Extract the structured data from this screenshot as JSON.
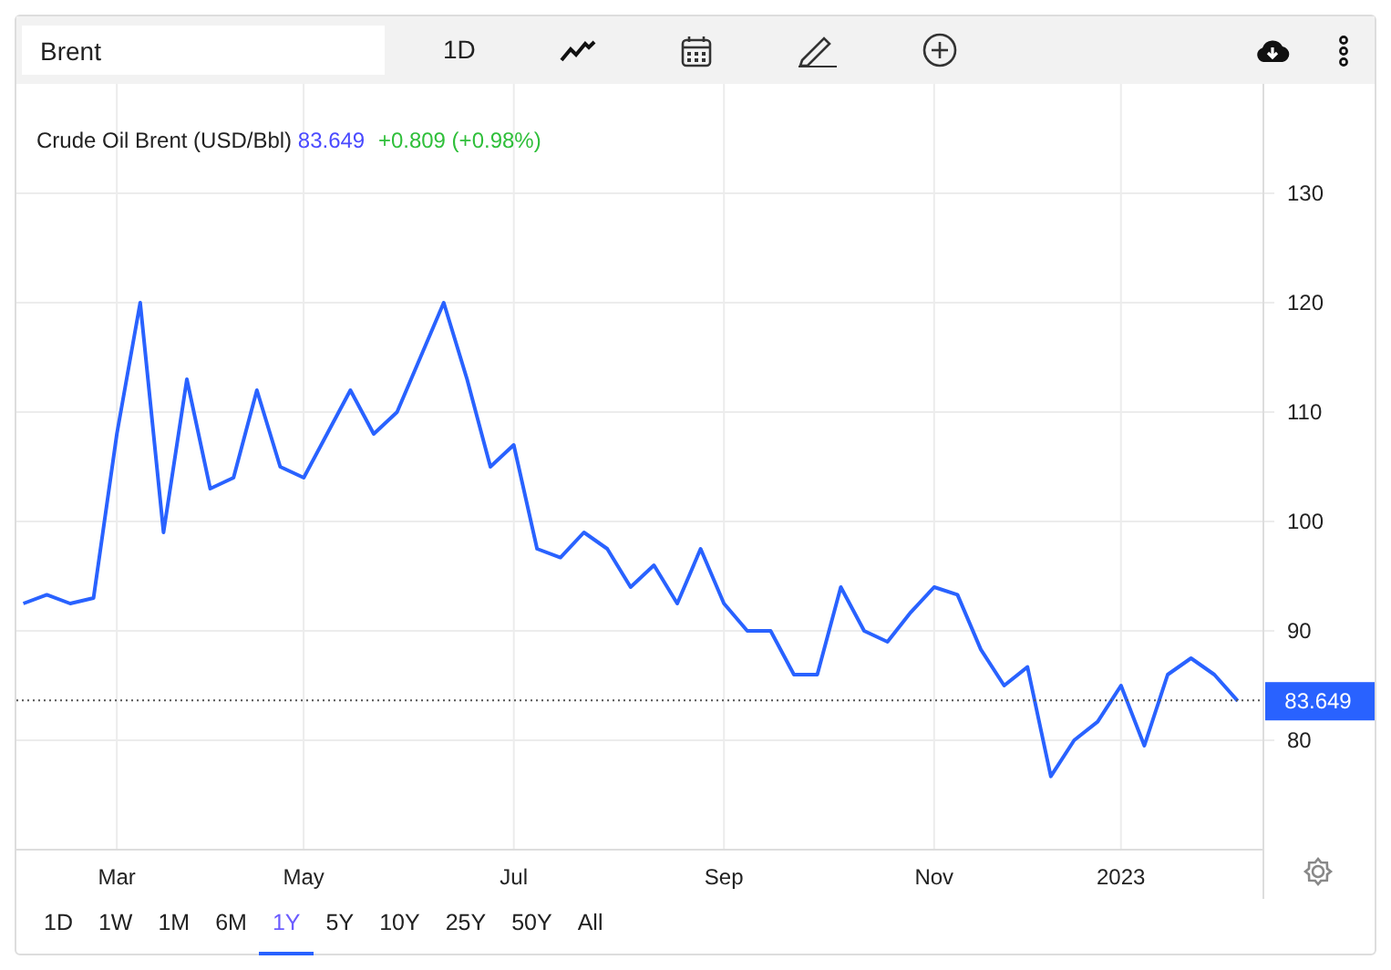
{
  "toolbar": {
    "search": {
      "value": "Brent"
    },
    "interval_button": "1D"
  },
  "legend": {
    "name": "Crude Oil Brent (USD/Bbl)",
    "price": "83.649",
    "change": "+0.809 (+0.98%)"
  },
  "price_tag": "83.649",
  "chart_data": {
    "type": "line",
    "categories": [
      null,
      null,
      null,
      null,
      "Mar",
      null,
      null,
      null,
      null,
      null,
      null,
      null,
      "May",
      null,
      null,
      null,
      null,
      null,
      null,
      null,
      null,
      "Jul",
      null,
      null,
      null,
      null,
      null,
      null,
      null,
      null,
      "Sep",
      null,
      null,
      null,
      null,
      null,
      null,
      null,
      null,
      "Nov",
      null,
      null,
      null,
      null,
      null,
      null,
      null,
      "2023",
      null,
      null,
      null,
      null,
      null
    ],
    "series": [
      {
        "color": "#2962ff",
        "values": [
          92.5,
          93.3,
          92.5,
          93,
          108,
          120,
          99,
          113,
          103,
          104,
          112,
          105,
          104,
          108,
          112,
          108,
          110,
          115,
          120,
          113,
          105,
          107,
          97.5,
          96.7,
          99,
          97.5,
          94,
          96,
          92.5,
          97.5,
          92.5,
          90,
          90,
          86,
          86,
          94,
          90,
          89,
          91.7,
          94,
          93.3,
          88.3,
          85,
          86.7,
          76.7,
          80,
          81.7,
          85,
          79.5,
          86,
          87.5,
          86,
          83.6
        ]
      }
    ],
    "ylim": [
      70,
      140
    ],
    "grid": true,
    "ref_lines": [
      {
        "axis": "y",
        "value": 83.649
      }
    ],
    "yticks": [
      80,
      90,
      100,
      110,
      120,
      130
    ]
  },
  "ranges": [
    {
      "label": "1D",
      "selected": false
    },
    {
      "label": "1W",
      "selected": false
    },
    {
      "label": "1M",
      "selected": false
    },
    {
      "label": "6M",
      "selected": false
    },
    {
      "label": "1Y",
      "selected": true
    },
    {
      "label": "5Y",
      "selected": false
    },
    {
      "label": "10Y",
      "selected": false
    },
    {
      "label": "25Y",
      "selected": false
    },
    {
      "label": "50Y",
      "selected": false
    },
    {
      "label": "All",
      "selected": false
    }
  ]
}
